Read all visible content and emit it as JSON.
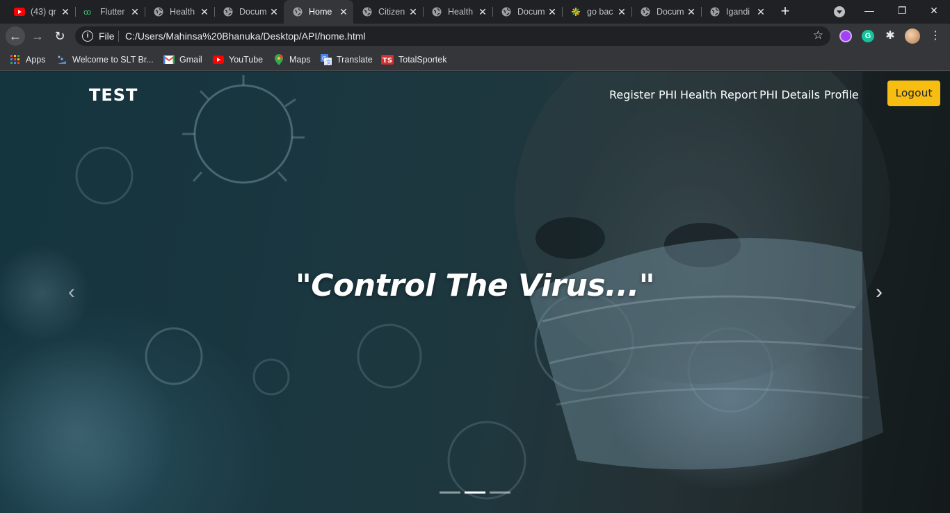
{
  "browser": {
    "tabs": [
      {
        "title": "(43) qr",
        "icon": "youtube-icon"
      },
      {
        "title": "Flutter",
        "icon": "flutter-icon"
      },
      {
        "title": "Health",
        "icon": "globe-icon"
      },
      {
        "title": "Docum",
        "icon": "globe-icon"
      },
      {
        "title": "Home",
        "icon": "globe-icon",
        "active": true
      },
      {
        "title": "Citizen",
        "icon": "globe-icon"
      },
      {
        "title": "Health",
        "icon": "globe-icon"
      },
      {
        "title": "Docum",
        "icon": "globe-icon"
      },
      {
        "title": "go bac",
        "icon": "app-icon"
      },
      {
        "title": "Docum",
        "icon": "globe-icon"
      },
      {
        "title": "Igandi",
        "icon": "globe-icon"
      }
    ],
    "address": {
      "scheme_label": "File",
      "url": "C:/Users/Mahinsa%20Bhanuka/Desktop/API/home.html"
    },
    "bookmarks": [
      {
        "label": "Apps",
        "icon": "apps-grid-icon"
      },
      {
        "label": "Welcome to SLT Br...",
        "icon": "slt-icon"
      },
      {
        "label": "Gmail",
        "icon": "gmail-icon"
      },
      {
        "label": "YouTube",
        "icon": "youtube-icon"
      },
      {
        "label": "Maps",
        "icon": "maps-pin-icon"
      },
      {
        "label": "Translate",
        "icon": "translate-icon"
      },
      {
        "label": "TotalSportek",
        "icon": "totalsportek-icon"
      }
    ]
  },
  "site": {
    "brand": "TEST",
    "nav": [
      "Register PHI",
      "Health Report",
      "PHI Details",
      "Profile"
    ],
    "logout_label": "Logout",
    "hero_caption": "\"Control The Virus...\"",
    "carousel": {
      "slide_count": 3,
      "active_index": 1
    },
    "colors": {
      "logout_bg": "#f7bd11",
      "hero_overlay": "#1f3a44"
    }
  }
}
